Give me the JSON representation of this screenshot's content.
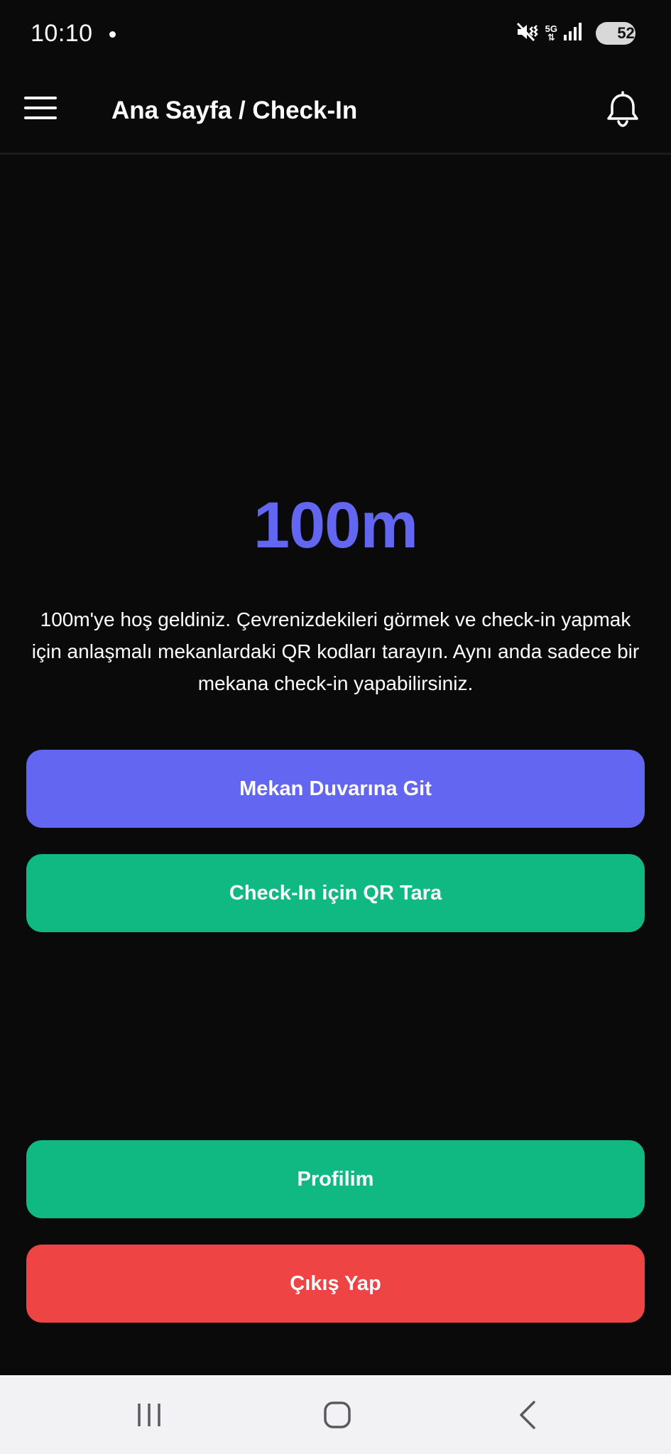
{
  "status_bar": {
    "time": "10:10",
    "network": "5G",
    "battery": "52",
    "battery_level": 0.52
  },
  "app_bar": {
    "title": "Ana Sayfa / Check-In"
  },
  "main": {
    "brand": "100m",
    "welcome_text": "100m'ye hoş geldiniz. Çevrenizdekileri görmek ve check-in yapmak için anlaşmalı mekanlardaki QR kodları tarayın. Aynı anda sadece bir mekana check-in yapabilirsiniz.",
    "venue_wall_button": "Mekan Duvarına Git",
    "scan_qr_button": "Check-In için QR Tara",
    "profile_button": "Profilim",
    "logout_button": "Çıkış Yap"
  },
  "colors": {
    "background": "#0a0a0b",
    "accent_indigo": "#6366f1",
    "accent_green": "#10b981",
    "danger_red": "#ef4444",
    "nav_bar": "#f2f2f4"
  },
  "icons": {
    "menu": "hamburger-menu-icon",
    "notifications": "bell-icon",
    "mute": "vibrate-mute-icon",
    "signal": "signal-bars-icon",
    "recents": "recents-icon",
    "home": "home-icon",
    "back": "back-icon"
  }
}
